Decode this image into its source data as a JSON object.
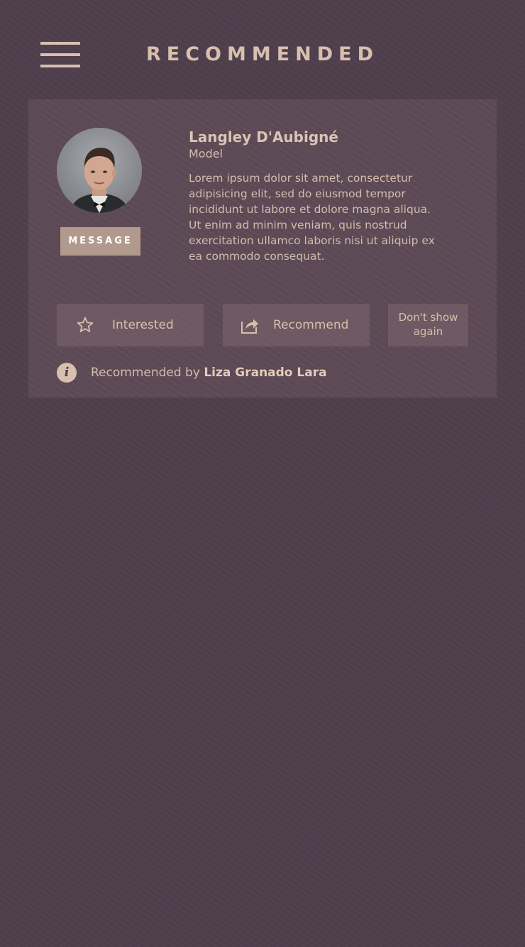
{
  "header": {
    "title": "RECOMMENDED",
    "menu_icon": "hamburger-menu-icon"
  },
  "profile": {
    "name": "Langley D'Aubigné",
    "role": "Model",
    "bio": "Lorem ipsum dolor sit amet, consectetur adipisicing elit, sed do eiusmod tempor incididunt ut labore et dolore magna aliqua. Ut enim ad minim veniam, quis nostrud exercitation ullamco laboris nisi ut aliquip ex ea commodo consequat.",
    "message_label": "MESSAGE"
  },
  "actions": {
    "interested": {
      "label": "Interested",
      "icon": "star-outline-icon"
    },
    "recommend": {
      "label": "Recommend",
      "icon": "share-icon"
    },
    "dont_show": {
      "label": "Don't show again"
    }
  },
  "recommended_by": {
    "prefix": "Recommended by ",
    "name": "Liza Granado Lara",
    "icon": "info-icon"
  },
  "colors": {
    "background": "#4f3f4d",
    "accent": "#d8bfae",
    "message_button": "#b19a8d"
  }
}
